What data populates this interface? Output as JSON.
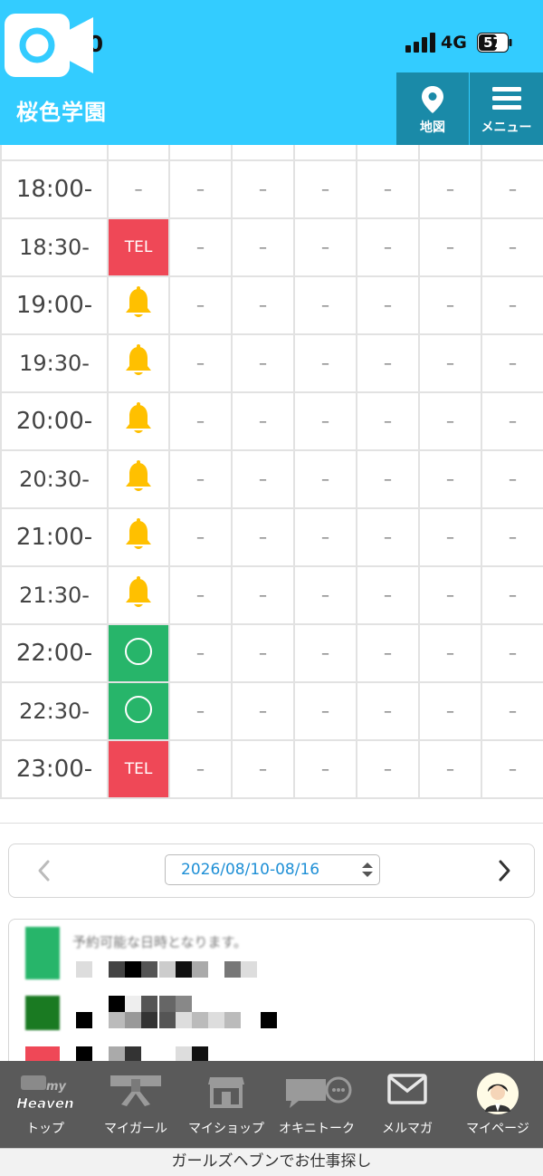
{
  "status_bar": {
    "time": "0:40",
    "network": "4G",
    "battery": "57"
  },
  "header": {
    "shop_name": "桜色学園",
    "map_label": "地図",
    "menu_label": "メニュー"
  },
  "schedule": {
    "column_count": 7,
    "dash": "–",
    "rows": [
      {
        "time": "18:00-",
        "first": "dash"
      },
      {
        "time": "18:30-",
        "first": "tel"
      },
      {
        "time": "19:00-",
        "first": "bell"
      },
      {
        "time": "19:30-",
        "first": "bell"
      },
      {
        "time": "20:00-",
        "first": "bell"
      },
      {
        "time": "20:30-",
        "first": "bell"
      },
      {
        "time": "21:00-",
        "first": "bell"
      },
      {
        "time": "21:30-",
        "first": "bell"
      },
      {
        "time": "22:00-",
        "first": "available"
      },
      {
        "time": "22:30-",
        "first": "available"
      },
      {
        "time": "23:00-",
        "first": "tel"
      }
    ],
    "tel_label": "TEL"
  },
  "week_nav": {
    "range": "2026/08/10-08/16",
    "prev_icon": "chevron-left-icon",
    "next_icon": "chevron-right-icon"
  },
  "legend": {
    "note": "予約可能な日時となります。"
  },
  "bottom_nav": {
    "items": [
      {
        "label": "トップ",
        "icon": "heaven-logo-icon"
      },
      {
        "label": "マイガール",
        "icon": "ribbon-icon"
      },
      {
        "label": "マイショップ",
        "icon": "shop-icon"
      },
      {
        "label": "オキニトーク",
        "icon": "chat-icon"
      },
      {
        "label": "メルマガ",
        "icon": "mail-icon"
      },
      {
        "label": "マイページ",
        "icon": "avatar-icon"
      }
    ],
    "heaven_text": "Heaven",
    "my_text": "my"
  },
  "footer": {
    "banner": "ガールズヘブンでお仕事探し"
  },
  "colors": {
    "header": "#33ccff",
    "tel": "#ef4857",
    "available": "#27b56a",
    "bell": "#ffc000",
    "nav": "#5a5a5a"
  }
}
